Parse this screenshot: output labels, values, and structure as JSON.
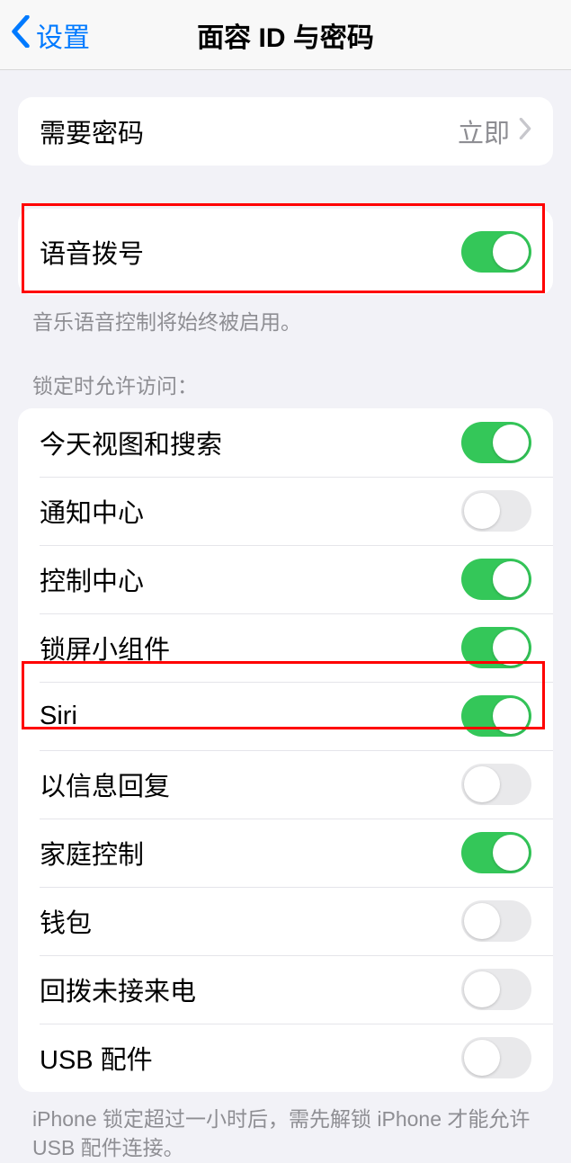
{
  "nav": {
    "back_label": "设置",
    "title": "面容 ID 与密码"
  },
  "require_passcode": {
    "label": "需要密码",
    "value": "立即"
  },
  "voice_dial": {
    "label": "语音拨号",
    "on": true,
    "footer": "音乐语音控制将始终被启用。"
  },
  "locked_access": {
    "header": "锁定时允许访问：",
    "items": [
      {
        "label": "今天视图和搜索",
        "on": true
      },
      {
        "label": "通知中心",
        "on": false
      },
      {
        "label": "控制中心",
        "on": true
      },
      {
        "label": "锁屏小组件",
        "on": true
      },
      {
        "label": "Siri",
        "on": true
      },
      {
        "label": "以信息回复",
        "on": false
      },
      {
        "label": "家庭控制",
        "on": true
      },
      {
        "label": "钱包",
        "on": false
      },
      {
        "label": "回拨未接来电",
        "on": false
      },
      {
        "label": "USB 配件",
        "on": false
      }
    ],
    "footer": "iPhone 锁定超过一小时后，需先解锁 iPhone 才能允许 USB 配件连接。"
  }
}
